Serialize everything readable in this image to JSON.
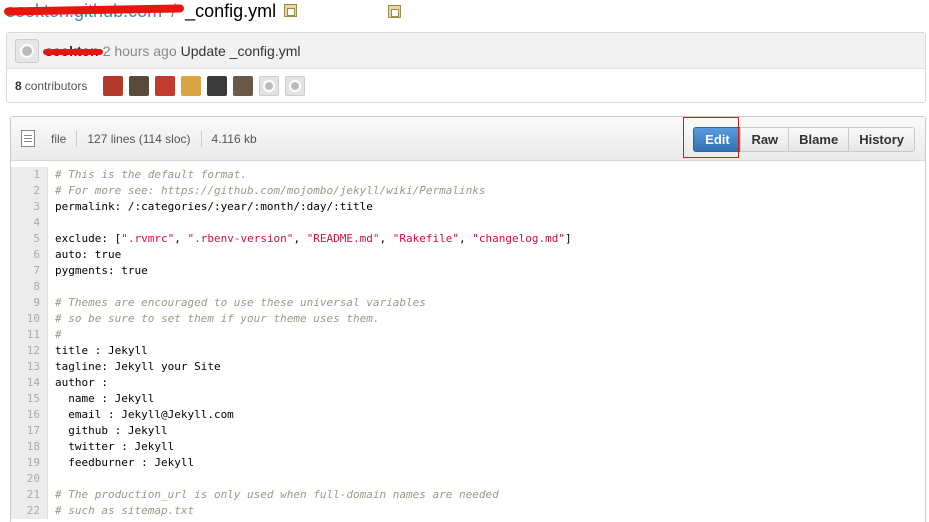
{
  "breadcrumb": {
    "repo": "seokton.github.com",
    "separator": "/",
    "file": "_config.yml"
  },
  "commit": {
    "author": "seokton",
    "time": "2 hours ago",
    "message": "Update _config.yml",
    "contributors_count": "8",
    "contributors_label": "contributors",
    "contributor_avatars": [
      "avatar-1",
      "avatar-2",
      "avatar-3",
      "avatar-4",
      "avatar-5",
      "avatar-6",
      "avatar-default",
      "avatar-default"
    ]
  },
  "file_header": {
    "type": "file",
    "lines": "127 lines (114 sloc)",
    "size": "4.116 kb"
  },
  "buttons": {
    "edit": "Edit",
    "raw": "Raw",
    "blame": "Blame",
    "history": "History"
  },
  "code_lines": [
    {
      "n": "1",
      "segments": [
        {
          "t": "# This is the default format.",
          "c": "comment"
        }
      ]
    },
    {
      "n": "2",
      "segments": [
        {
          "t": "# For more see: https://github.com/mojombo/jekyll/wiki/Permalinks",
          "c": "comment"
        }
      ]
    },
    {
      "n": "3",
      "segments": [
        {
          "t": "permalink: /:categories/:year/:month/:day/:title",
          "c": ""
        }
      ]
    },
    {
      "n": "4",
      "segments": []
    },
    {
      "n": "5",
      "segments": [
        {
          "t": "exclude: [",
          "c": ""
        },
        {
          "t": "\".rvmrc\"",
          "c": "string"
        },
        {
          "t": ", ",
          "c": ""
        },
        {
          "t": "\".rbenv-version\"",
          "c": "string"
        },
        {
          "t": ", ",
          "c": ""
        },
        {
          "t": "\"README.md\"",
          "c": "string"
        },
        {
          "t": ", ",
          "c": ""
        },
        {
          "t": "\"Rakefile\"",
          "c": "string"
        },
        {
          "t": ", ",
          "c": ""
        },
        {
          "t": "\"changelog.md\"",
          "c": "string"
        },
        {
          "t": "]",
          "c": ""
        }
      ]
    },
    {
      "n": "6",
      "segments": [
        {
          "t": "auto: true",
          "c": ""
        }
      ]
    },
    {
      "n": "7",
      "segments": [
        {
          "t": "pygments: true",
          "c": ""
        }
      ]
    },
    {
      "n": "8",
      "segments": []
    },
    {
      "n": "9",
      "segments": [
        {
          "t": "# Themes are encouraged to use these universal variables",
          "c": "comment"
        }
      ]
    },
    {
      "n": "10",
      "segments": [
        {
          "t": "# so be sure to set them if your theme uses them.",
          "c": "comment"
        }
      ]
    },
    {
      "n": "11",
      "segments": [
        {
          "t": "#",
          "c": "comment"
        }
      ]
    },
    {
      "n": "12",
      "segments": [
        {
          "t": "title : Jekyll",
          "c": ""
        }
      ]
    },
    {
      "n": "13",
      "segments": [
        {
          "t": "tagline: Jekyll your Site",
          "c": ""
        }
      ]
    },
    {
      "n": "14",
      "segments": [
        {
          "t": "author :",
          "c": ""
        }
      ]
    },
    {
      "n": "15",
      "segments": [
        {
          "t": "  name : Jekyll",
          "c": ""
        }
      ]
    },
    {
      "n": "16",
      "segments": [
        {
          "t": "  email : Jekyll@Jekyll.com",
          "c": ""
        }
      ]
    },
    {
      "n": "17",
      "segments": [
        {
          "t": "  github : Jekyll",
          "c": ""
        }
      ]
    },
    {
      "n": "18",
      "segments": [
        {
          "t": "  twitter : Jekyll",
          "c": ""
        }
      ]
    },
    {
      "n": "19",
      "segments": [
        {
          "t": "  feedburner : Jekyll",
          "c": ""
        }
      ]
    },
    {
      "n": "20",
      "segments": []
    },
    {
      "n": "21",
      "segments": [
        {
          "t": "# The production_url is only used when full-domain names are needed",
          "c": "comment"
        }
      ]
    },
    {
      "n": "22",
      "segments": [
        {
          "t": "# such as sitemap.txt",
          "c": "comment"
        }
      ]
    }
  ]
}
